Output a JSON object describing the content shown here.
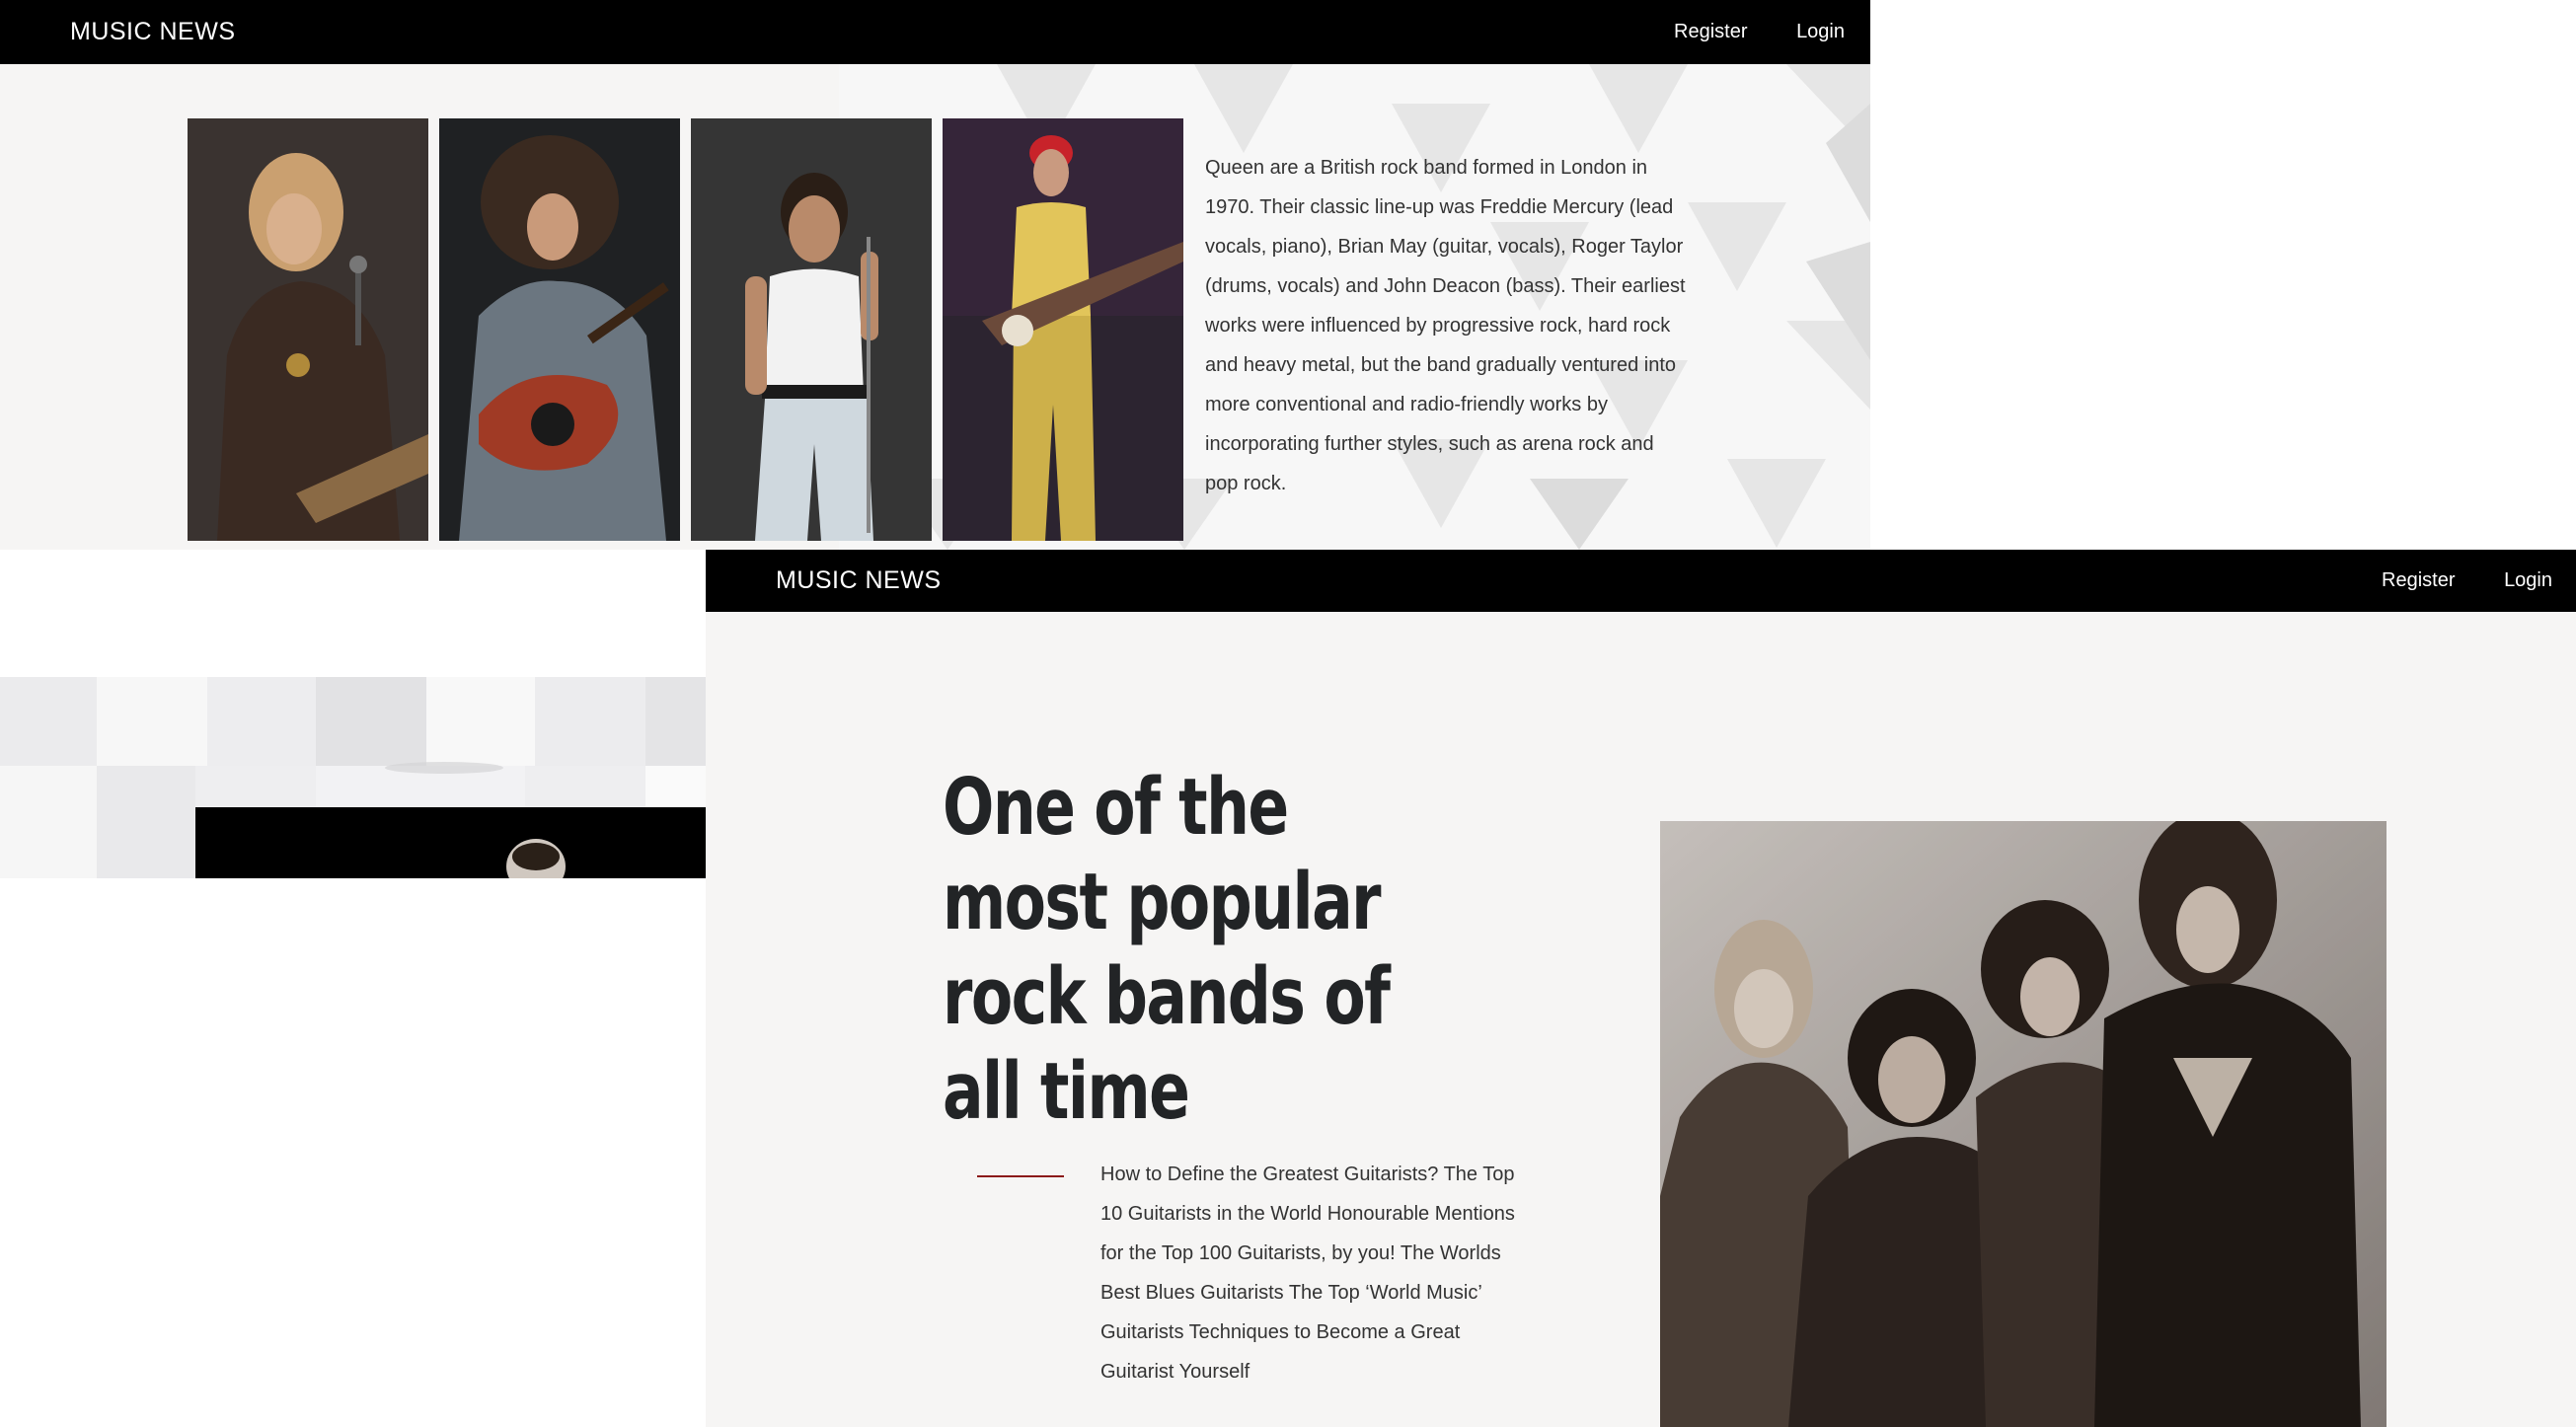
{
  "window_top": {
    "brand": "MUSIC NEWS",
    "nav": {
      "register": "Register",
      "login": "Login"
    },
    "intro": "Queen are a British rock band formed in London in 1970. Their classic line-up was Freddie Mercury (lead vocals, piano), Brian May (guitar, vocals), Roger Taylor (drums, vocals) and John Deacon (bass). Their earliest works were influenced by progressive rock, hard rock and heavy metal, but the band gradually ventured into more conventional and radio-friendly works by incorporating further styles, such as arena rock and pop rock."
  },
  "window_bottom": {
    "brand": "MUSIC NEWS",
    "nav": {
      "register": "Register",
      "login": "Login"
    },
    "headline": "One of the most popular rock bands of all time",
    "articles": "How to Define the Greatest Guitarists? The Top 10 Guitarists in the World Honourable Mentions for the Top 100 Guitarists, by you! The Worlds Best Blues Guitarists The Top ‘World Music’ Guitarists Techniques to Become a Great Guitarist Yourself"
  },
  "colors": {
    "navbar": "#000000",
    "page_bg": "#f6f5f4",
    "headline": "#222426",
    "accent_line": "#8b1a1a",
    "body_text": "#333333"
  }
}
